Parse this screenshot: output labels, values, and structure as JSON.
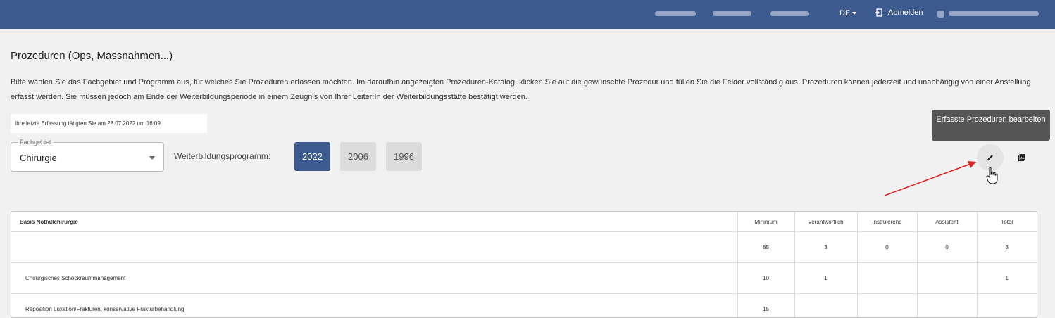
{
  "header": {
    "language": "DE",
    "logout_label": "Abmelden",
    "bg_color": "#3c5a8e"
  },
  "page": {
    "title": "Prozeduren (Ops, Massnahmen...)",
    "intro": "Bitte wählen Sie das Fachgebiet und Programm aus, für welches Sie Prozeduren erfassen möchten. Im daraufhin angezeigten Prozeduren-Katalog, klicken Sie auf die gewünschte Prozedur und füllen Sie die Felder vollständig aus. Prozeduren können jederzeit und unabhängig von einer Anstellung erfasst werden. Sie müssen jedoch am Ende der Weiterbildungsperiode in einem Zeugnis von Ihrer Leiter:In der Weiterbildungsstätte bestätigt werden.",
    "last_entry": "Ihre letzte Erfassung tätigten Sie am 28.07.2022 um 16:09"
  },
  "filter": {
    "fachgebiet_label": "Fachgebiet",
    "fachgebiet_value": "Chirurgie",
    "program_label": "Weiterbildungsprogramm:",
    "years": [
      "2022",
      "2006",
      "1996"
    ],
    "active_year": "2022"
  },
  "actions": {
    "tooltip": "Erfasste Prozeduren bearbeiten",
    "edit_icon": "pencil-icon",
    "gallery_icon": "photo-library-icon"
  },
  "table": {
    "section_name": "Basis Notfallchirurgie",
    "columns": [
      "Minimum",
      "Verantwortlich",
      "Instruierend",
      "Assistent",
      "Total"
    ],
    "totals": [
      "85",
      "3",
      "0",
      "0",
      "3"
    ],
    "rows": [
      {
        "name": "Chirurgisches Schockraummanagement",
        "values": [
          "10",
          "1",
          "",
          "",
          "1"
        ]
      },
      {
        "name": "Reposition Luxation/Frakturen, konservative Frakturbehandlung",
        "values": [
          "15",
          "",
          "",
          "",
          ""
        ]
      }
    ]
  }
}
